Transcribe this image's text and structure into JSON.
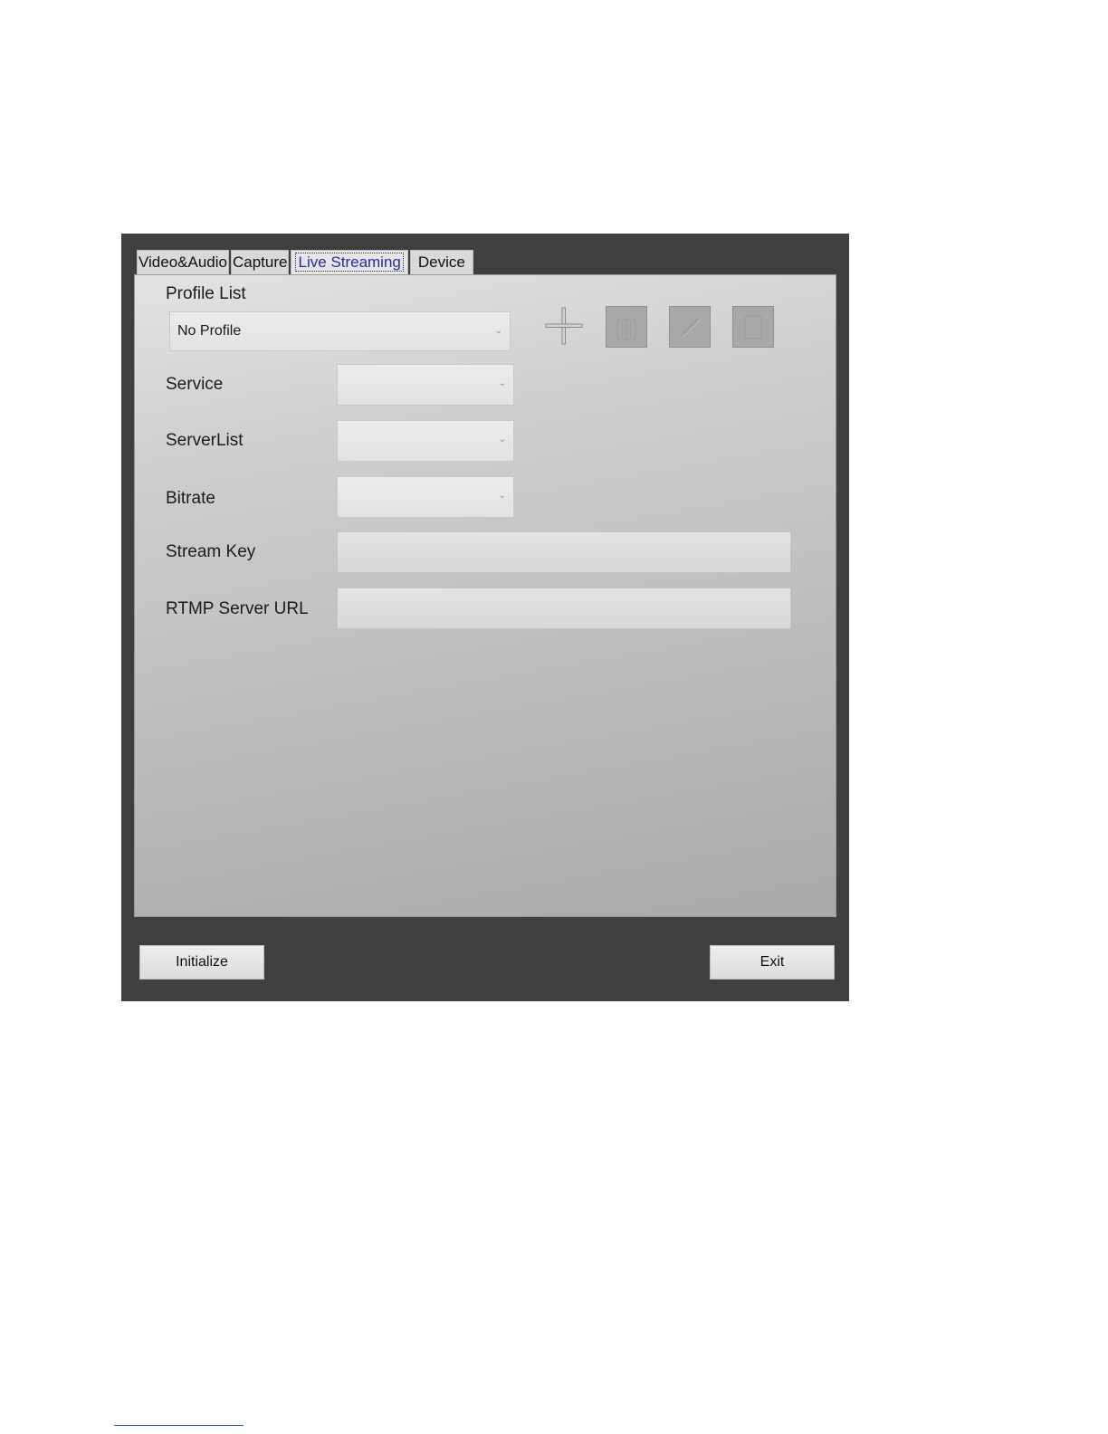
{
  "tabs": [
    {
      "label": "Video&Audio"
    },
    {
      "label": "Capture"
    },
    {
      "label": "Live Streaming"
    },
    {
      "label": "Device"
    }
  ],
  "active_tab": "Live Streaming",
  "profile": {
    "label": "Profile List",
    "selected": "No Profile"
  },
  "toolbar": {
    "icons": [
      "plus-icon",
      "delete-icon",
      "edit-icon",
      "save-icon"
    ]
  },
  "fields": {
    "service": {
      "label": "Service",
      "value": ""
    },
    "server_list": {
      "label": "ServerList",
      "value": ""
    },
    "bitrate": {
      "label": "Bitrate",
      "value": ""
    },
    "stream_key": {
      "label": "Stream Key",
      "value": ""
    },
    "rtmp_url": {
      "label": "RTMP Server URL",
      "value": ""
    }
  },
  "buttons": {
    "initialize": "Initialize",
    "exit": "Exit"
  },
  "colors": {
    "window_bg": "#3f3f3f",
    "active_tab_text": "#2a2aa8",
    "panel_top": "#e3e3e3",
    "panel_bottom": "#a9a9a9"
  }
}
